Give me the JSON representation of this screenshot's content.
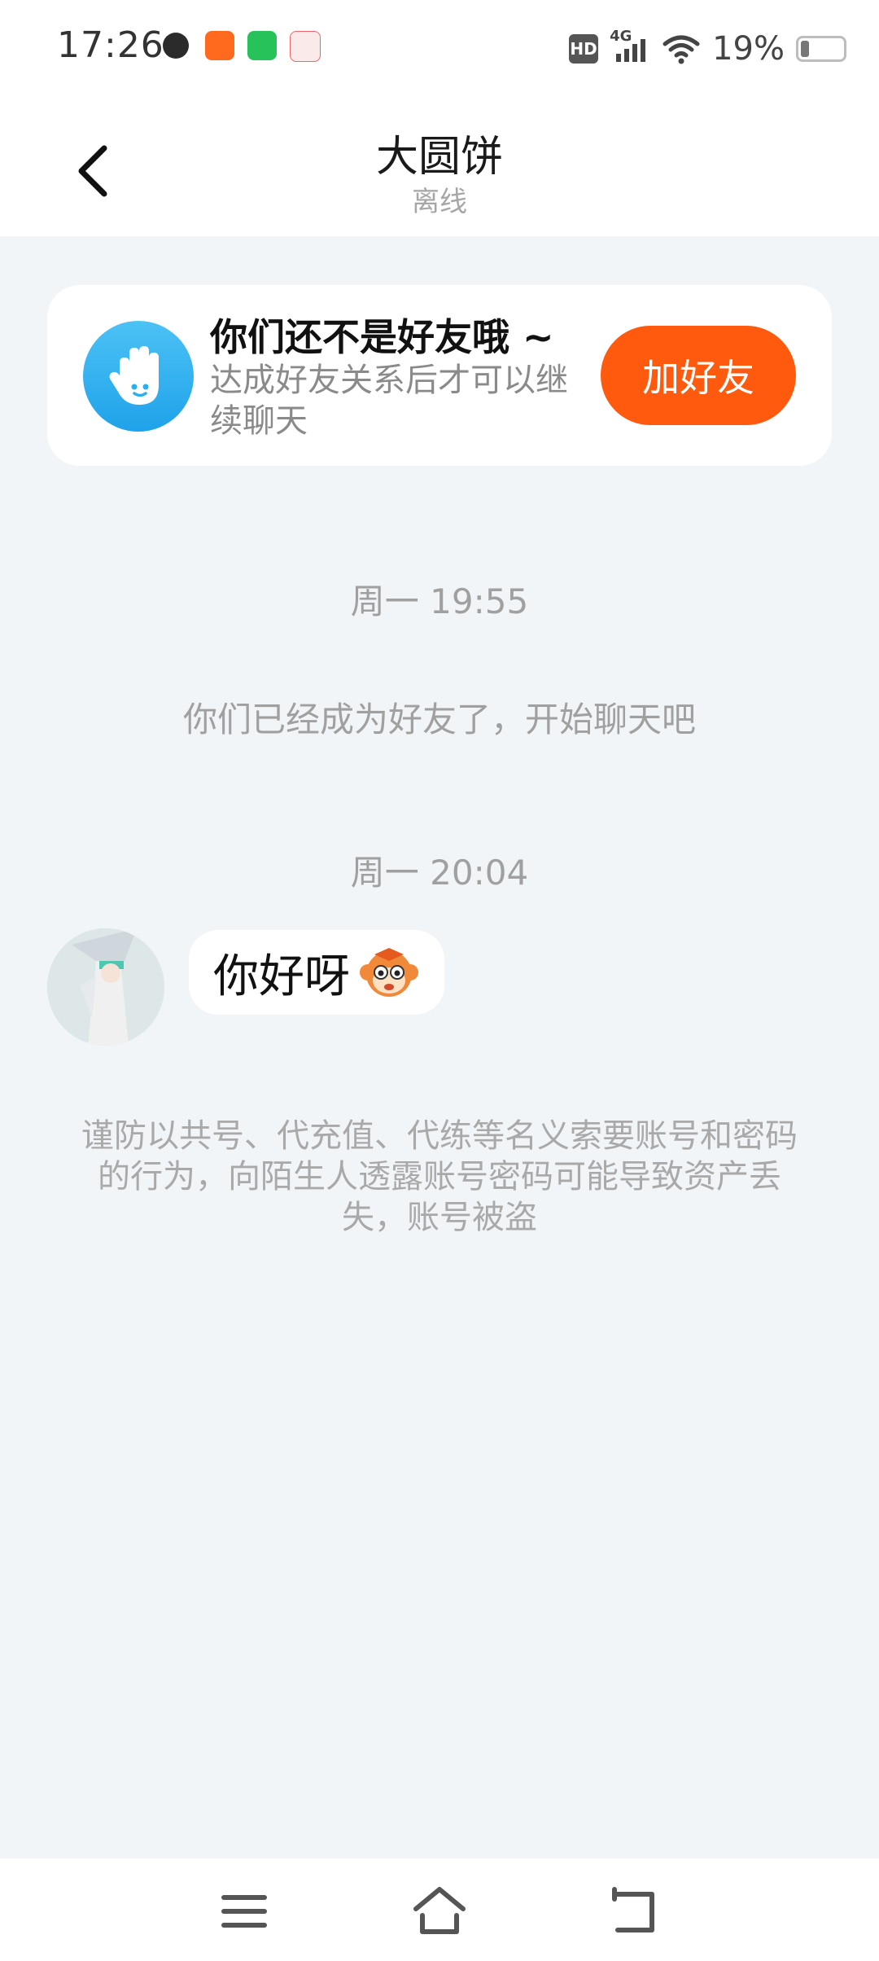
{
  "status_bar": {
    "time": "17:26",
    "hd": "HD",
    "network": "4G",
    "battery_percent": "19%",
    "battery_level": 0.19
  },
  "header": {
    "title": "大圆饼",
    "subtitle": "离线"
  },
  "friend_card": {
    "title": "你们还不是好友哦 ~",
    "description": "达成好友关系后才可以继续聊天",
    "button_label": "加好友"
  },
  "chat": {
    "time_1": "周一 19:55",
    "system_message": "你们已经成为好友了，开始聊天吧",
    "time_2": "周一 20:04",
    "message_text": "你好呀",
    "warning": "谨防以共号、代充值、代练等名义索要账号和密码的行为，向陌生人透露账号密码可能导致资产丢失，账号被盗"
  },
  "colors": {
    "accent": "#ff5a0e",
    "background": "#f2f5f8",
    "wave_icon": "#29aef0"
  }
}
